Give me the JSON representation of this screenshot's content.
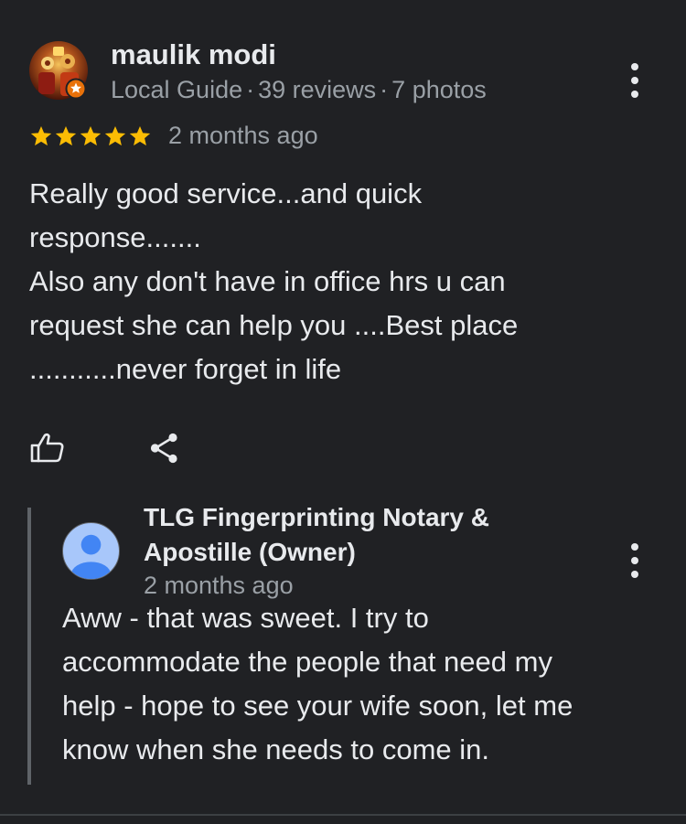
{
  "review": {
    "author_name": "maulik modi",
    "author_badge": "Local Guide",
    "review_count": "39 reviews",
    "photo_count": "7 photos",
    "meta_separator": "·",
    "rating": 5,
    "rating_max": 5,
    "time": "2 months ago",
    "text_lines": [
      "Really good service...and quick",
      "response.......",
      "Also any don't have in office hrs u can",
      "request she can help you ....Best place",
      "...........never forget in life"
    ]
  },
  "actions": {
    "like_icon": "thumb-up-icon",
    "share_icon": "share-icon"
  },
  "owner_reply": {
    "name_lines": [
      "TLG Fingerprinting Notary &",
      "Apostille (Owner)"
    ],
    "time": "2 months ago",
    "text_lines": [
      "Aww - that was sweet. I try to",
      "accommodate the people that need my",
      "help - hope to see your wife soon, let me",
      "know when she needs to come in."
    ]
  },
  "colors": {
    "background": "#202124",
    "primary_text": "#e8eaed",
    "secondary_text": "#9aa0a6",
    "star": "#fbbc04",
    "local_guide_badge": "#e8710a",
    "default_avatar_bg": "#a8c7fa",
    "default_avatar_fg": "#4285f4",
    "reply_bar": "#5f6368"
  }
}
